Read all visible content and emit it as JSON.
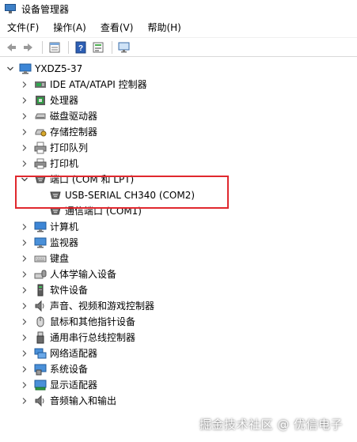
{
  "window": {
    "title": "设备管理器"
  },
  "menu": [
    "文件(F)",
    "操作(A)",
    "查看(V)",
    "帮助(H)"
  ],
  "tree": {
    "root": "YXDZ5-37",
    "items": [
      {
        "label": "IDE ATA/ATAPI 控制器",
        "icon": "ide-controller-icon"
      },
      {
        "label": "处理器",
        "icon": "processor-icon"
      },
      {
        "label": "磁盘驱动器",
        "icon": "disk-drive-icon"
      },
      {
        "label": "存储控制器",
        "icon": "storage-controller-icon"
      },
      {
        "label": "打印队列",
        "icon": "print-queue-icon"
      },
      {
        "label": "打印机",
        "icon": "printer-icon"
      },
      {
        "label": "端口 (COM 和 LPT)",
        "icon": "port-icon",
        "expanded": true,
        "children": [
          {
            "label": "USB-SERIAL CH340 (COM2)",
            "icon": "port-icon"
          },
          {
            "label": "通信端口 (COM1)",
            "icon": "port-icon"
          }
        ]
      },
      {
        "label": "计算机",
        "icon": "computer-icon"
      },
      {
        "label": "监视器",
        "icon": "monitor-icon"
      },
      {
        "label": "键盘",
        "icon": "keyboard-icon"
      },
      {
        "label": "人体学输入设备",
        "icon": "hid-icon"
      },
      {
        "label": "软件设备",
        "icon": "software-device-icon"
      },
      {
        "label": "声音、视频和游戏控制器",
        "icon": "sound-icon"
      },
      {
        "label": "鼠标和其他指针设备",
        "icon": "mouse-icon"
      },
      {
        "label": "通用串行总线控制器",
        "icon": "usb-icon"
      },
      {
        "label": "网络适配器",
        "icon": "network-icon"
      },
      {
        "label": "系统设备",
        "icon": "system-device-icon"
      },
      {
        "label": "显示适配器",
        "icon": "display-adapter-icon"
      },
      {
        "label": "音频输入和输出",
        "icon": "audio-io-icon"
      }
    ]
  },
  "watermark": "掘金技术社区 @ 优信电子",
  "colors": {
    "highlight": "#e0282e"
  }
}
